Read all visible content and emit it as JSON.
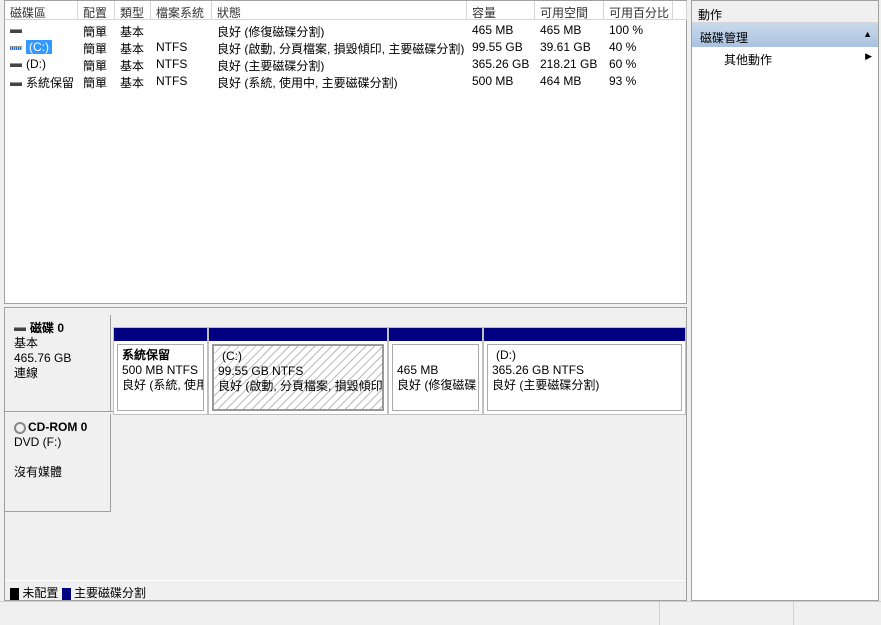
{
  "columns": [
    "磁碟區",
    "配置",
    "類型",
    "檔案系統",
    "狀態",
    "容量",
    "可用空間",
    "可用百分比"
  ],
  "volumes": [
    {
      "name": "",
      "layout": "簡單",
      "type": "基本",
      "fs": "",
      "status": "良好 (修復磁碟分割)",
      "capacity": "465 MB",
      "free": "465 MB",
      "pct": "100 %"
    },
    {
      "name": "(C:)",
      "layout": "簡單",
      "type": "基本",
      "fs": "NTFS",
      "status": "良好 (啟動, 分頁檔案, 損毀傾印, 主要磁碟分割)",
      "capacity": "99.55 GB",
      "free": "39.61 GB",
      "pct": "40 %"
    },
    {
      "name": "(D:)",
      "layout": "簡單",
      "type": "基本",
      "fs": "NTFS",
      "status": "良好 (主要磁碟分割)",
      "capacity": "365.26 GB",
      "free": "218.21 GB",
      "pct": "60 %"
    },
    {
      "name": "系統保留",
      "layout": "簡單",
      "type": "基本",
      "fs": "NTFS",
      "status": "良好 (系統, 使用中, 主要磁碟分割)",
      "capacity": "500 MB",
      "free": "464 MB",
      "pct": "93 %"
    }
  ],
  "disk0": {
    "name": "磁碟 0",
    "type": "基本",
    "size": "465.76 GB",
    "state": "連線",
    "partitions": [
      {
        "label": "系統保留",
        "size": "500 MB NTFS",
        "status": "良好 (系統, 使用"
      },
      {
        "label": "(C:)",
        "size": "99.55 GB NTFS",
        "status": "良好 (啟動, 分頁檔案, 損毀傾印"
      },
      {
        "label": "",
        "size": "465 MB",
        "status": "良好 (修復磁碟"
      },
      {
        "label": "(D:)",
        "size": "365.26 GB NTFS",
        "status": "良好 (主要磁碟分割)"
      }
    ]
  },
  "cdrom": {
    "name": "CD-ROM 0",
    "type": "DVD (F:)",
    "state": "沒有媒體"
  },
  "legend": {
    "unallocated": "未配置",
    "primary": "主要磁碟分割"
  },
  "actions": {
    "title": "動作",
    "section": "磁碟管理",
    "more": "其他動作"
  }
}
